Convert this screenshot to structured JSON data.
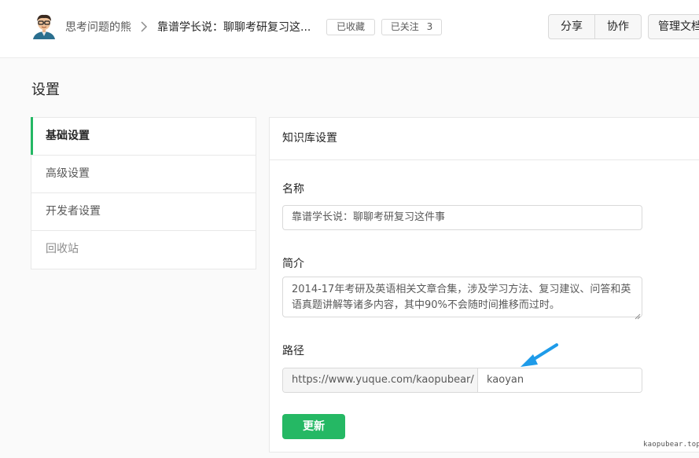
{
  "header": {
    "user_name": "思考问题的熊",
    "book_title": "靠谱学长说：聊聊考研复习这...",
    "collected_label": "已收藏",
    "followed_label": "已关注",
    "followed_count": "3",
    "share_label": "分享",
    "collaborate_label": "协作",
    "manage_label": "管理文档"
  },
  "page": {
    "title": "设置"
  },
  "sidebar": {
    "items": [
      {
        "label": "基础设置"
      },
      {
        "label": "高级设置"
      },
      {
        "label": "开发者设置"
      },
      {
        "label": "回收站"
      }
    ]
  },
  "panel": {
    "header": "知识库设置",
    "name_label": "名称",
    "name_value": "靠谱学长说：聊聊考研复习这件事",
    "desc_label": "简介",
    "desc_value": "2014-17年考研及英语相关文章合集，涉及学习方法、复习建议、问答和英语真题讲解等诸多内容，其中90%不会随时间推移而过时。",
    "path_label": "路径",
    "path_prefix": "https://www.yuque.com/kaopubear/",
    "path_value": "kaoyan",
    "update_label": "更新"
  },
  "watermark": "kaopubear.top",
  "colors": {
    "accent": "#25b864",
    "annotation_arrow": "#1e9be9"
  }
}
